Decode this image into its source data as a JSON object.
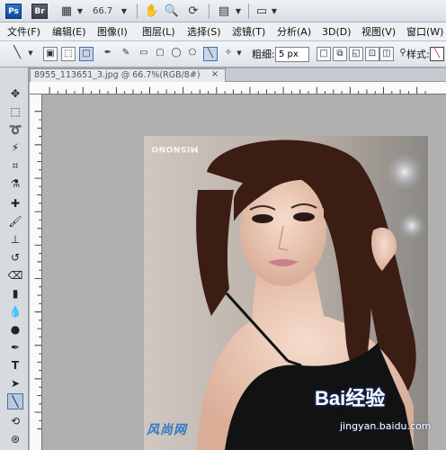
{
  "appbar": {
    "ps_label": "Ps",
    "br_label": "Br",
    "zoom_value": "66.7"
  },
  "menu": {
    "items": [
      "文件(F)",
      "编辑(E)",
      "图像(I)",
      "图层(L)",
      "选择(S)",
      "滤镜(T)",
      "分析(A)",
      "3D(D)",
      "视图(V)",
      "窗口(W)"
    ]
  },
  "options": {
    "weight_label": "粗细:",
    "weight_value": "5 px",
    "style_label": "样式:"
  },
  "document": {
    "tab_title": "8955_113651_3.jpg @ 66.7%(RGB/8#)",
    "close_glyph": "×"
  },
  "photo": {
    "watermark_top": "MISNONO",
    "watermark_bottom": "风尚网",
    "baidu_logo": "Bai经验",
    "baidu_url": "jingyan.baidu.com"
  },
  "colors": {
    "ps_blue": "#1f5fb0",
    "ui_panel": "#d7dbe0",
    "canvas_gray": "#b0b0b0",
    "menu_bg": "#eef0f3"
  }
}
